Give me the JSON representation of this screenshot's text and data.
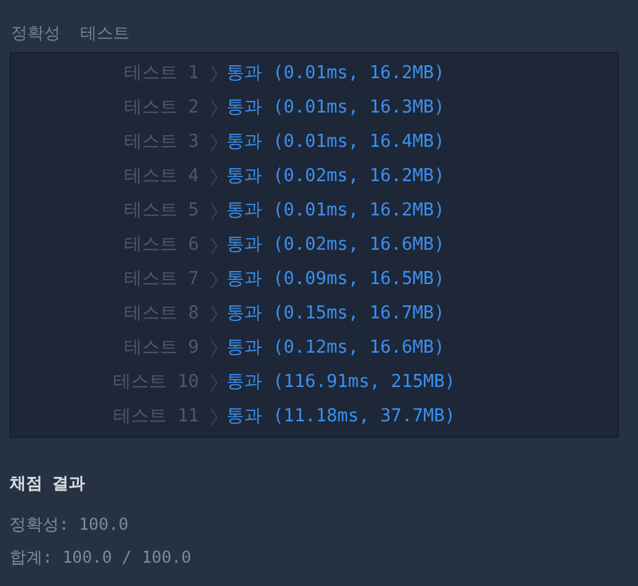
{
  "section_title": "정확성  테스트",
  "tests": [
    {
      "label": "테스트 1",
      "result": "통과 (0.01ms, 16.2MB)",
      "passed": true
    },
    {
      "label": "테스트 2",
      "result": "통과 (0.01ms, 16.3MB)",
      "passed": true
    },
    {
      "label": "테스트 3",
      "result": "통과 (0.01ms, 16.4MB)",
      "passed": true
    },
    {
      "label": "테스트 4",
      "result": "통과 (0.02ms, 16.2MB)",
      "passed": true
    },
    {
      "label": "테스트 5",
      "result": "통과 (0.01ms, 16.2MB)",
      "passed": true
    },
    {
      "label": "테스트 6",
      "result": "통과 (0.02ms, 16.6MB)",
      "passed": true
    },
    {
      "label": "테스트 7",
      "result": "통과 (0.09ms, 16.5MB)",
      "passed": true
    },
    {
      "label": "테스트 8",
      "result": "통과 (0.15ms, 16.7MB)",
      "passed": true
    },
    {
      "label": "테스트 9",
      "result": "통과 (0.12ms, 16.6MB)",
      "passed": true
    },
    {
      "label": "테스트 10",
      "result": "통과 (116.91ms, 215MB)",
      "passed": true
    },
    {
      "label": "테스트 11",
      "result": "통과 (11.18ms, 37.7MB)",
      "passed": true
    }
  ],
  "summary": {
    "title": "채점 결과",
    "lines": [
      "정확성: 100.0",
      "합계: 100.0 / 100.0"
    ]
  }
}
